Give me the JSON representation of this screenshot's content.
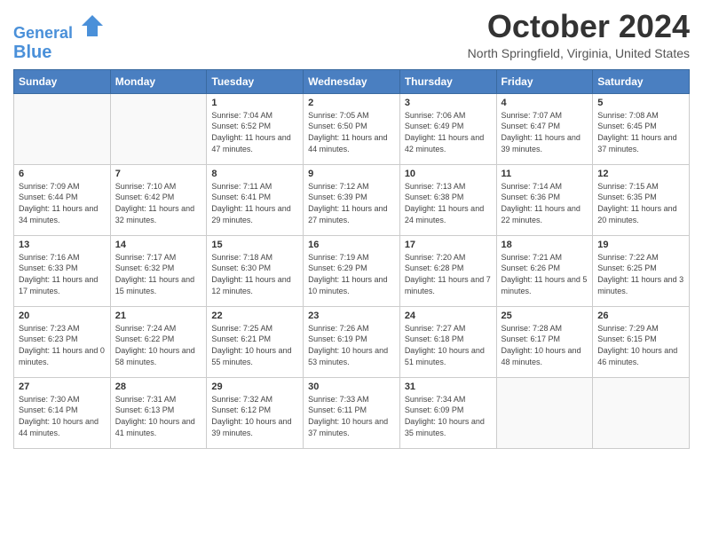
{
  "header": {
    "logo_line1": "General",
    "logo_line2": "Blue",
    "month_title": "October 2024",
    "location": "North Springfield, Virginia, United States"
  },
  "days_of_week": [
    "Sunday",
    "Monday",
    "Tuesday",
    "Wednesday",
    "Thursday",
    "Friday",
    "Saturday"
  ],
  "weeks": [
    [
      {
        "day": "",
        "info": ""
      },
      {
        "day": "",
        "info": ""
      },
      {
        "day": "1",
        "info": "Sunrise: 7:04 AM\nSunset: 6:52 PM\nDaylight: 11 hours and 47 minutes."
      },
      {
        "day": "2",
        "info": "Sunrise: 7:05 AM\nSunset: 6:50 PM\nDaylight: 11 hours and 44 minutes."
      },
      {
        "day": "3",
        "info": "Sunrise: 7:06 AM\nSunset: 6:49 PM\nDaylight: 11 hours and 42 minutes."
      },
      {
        "day": "4",
        "info": "Sunrise: 7:07 AM\nSunset: 6:47 PM\nDaylight: 11 hours and 39 minutes."
      },
      {
        "day": "5",
        "info": "Sunrise: 7:08 AM\nSunset: 6:45 PM\nDaylight: 11 hours and 37 minutes."
      }
    ],
    [
      {
        "day": "6",
        "info": "Sunrise: 7:09 AM\nSunset: 6:44 PM\nDaylight: 11 hours and 34 minutes."
      },
      {
        "day": "7",
        "info": "Sunrise: 7:10 AM\nSunset: 6:42 PM\nDaylight: 11 hours and 32 minutes."
      },
      {
        "day": "8",
        "info": "Sunrise: 7:11 AM\nSunset: 6:41 PM\nDaylight: 11 hours and 29 minutes."
      },
      {
        "day": "9",
        "info": "Sunrise: 7:12 AM\nSunset: 6:39 PM\nDaylight: 11 hours and 27 minutes."
      },
      {
        "day": "10",
        "info": "Sunrise: 7:13 AM\nSunset: 6:38 PM\nDaylight: 11 hours and 24 minutes."
      },
      {
        "day": "11",
        "info": "Sunrise: 7:14 AM\nSunset: 6:36 PM\nDaylight: 11 hours and 22 minutes."
      },
      {
        "day": "12",
        "info": "Sunrise: 7:15 AM\nSunset: 6:35 PM\nDaylight: 11 hours and 20 minutes."
      }
    ],
    [
      {
        "day": "13",
        "info": "Sunrise: 7:16 AM\nSunset: 6:33 PM\nDaylight: 11 hours and 17 minutes."
      },
      {
        "day": "14",
        "info": "Sunrise: 7:17 AM\nSunset: 6:32 PM\nDaylight: 11 hours and 15 minutes."
      },
      {
        "day": "15",
        "info": "Sunrise: 7:18 AM\nSunset: 6:30 PM\nDaylight: 11 hours and 12 minutes."
      },
      {
        "day": "16",
        "info": "Sunrise: 7:19 AM\nSunset: 6:29 PM\nDaylight: 11 hours and 10 minutes."
      },
      {
        "day": "17",
        "info": "Sunrise: 7:20 AM\nSunset: 6:28 PM\nDaylight: 11 hours and 7 minutes."
      },
      {
        "day": "18",
        "info": "Sunrise: 7:21 AM\nSunset: 6:26 PM\nDaylight: 11 hours and 5 minutes."
      },
      {
        "day": "19",
        "info": "Sunrise: 7:22 AM\nSunset: 6:25 PM\nDaylight: 11 hours and 3 minutes."
      }
    ],
    [
      {
        "day": "20",
        "info": "Sunrise: 7:23 AM\nSunset: 6:23 PM\nDaylight: 11 hours and 0 minutes."
      },
      {
        "day": "21",
        "info": "Sunrise: 7:24 AM\nSunset: 6:22 PM\nDaylight: 10 hours and 58 minutes."
      },
      {
        "day": "22",
        "info": "Sunrise: 7:25 AM\nSunset: 6:21 PM\nDaylight: 10 hours and 55 minutes."
      },
      {
        "day": "23",
        "info": "Sunrise: 7:26 AM\nSunset: 6:19 PM\nDaylight: 10 hours and 53 minutes."
      },
      {
        "day": "24",
        "info": "Sunrise: 7:27 AM\nSunset: 6:18 PM\nDaylight: 10 hours and 51 minutes."
      },
      {
        "day": "25",
        "info": "Sunrise: 7:28 AM\nSunset: 6:17 PM\nDaylight: 10 hours and 48 minutes."
      },
      {
        "day": "26",
        "info": "Sunrise: 7:29 AM\nSunset: 6:15 PM\nDaylight: 10 hours and 46 minutes."
      }
    ],
    [
      {
        "day": "27",
        "info": "Sunrise: 7:30 AM\nSunset: 6:14 PM\nDaylight: 10 hours and 44 minutes."
      },
      {
        "day": "28",
        "info": "Sunrise: 7:31 AM\nSunset: 6:13 PM\nDaylight: 10 hours and 41 minutes."
      },
      {
        "day": "29",
        "info": "Sunrise: 7:32 AM\nSunset: 6:12 PM\nDaylight: 10 hours and 39 minutes."
      },
      {
        "day": "30",
        "info": "Sunrise: 7:33 AM\nSunset: 6:11 PM\nDaylight: 10 hours and 37 minutes."
      },
      {
        "day": "31",
        "info": "Sunrise: 7:34 AM\nSunset: 6:09 PM\nDaylight: 10 hours and 35 minutes."
      },
      {
        "day": "",
        "info": ""
      },
      {
        "day": "",
        "info": ""
      }
    ]
  ]
}
